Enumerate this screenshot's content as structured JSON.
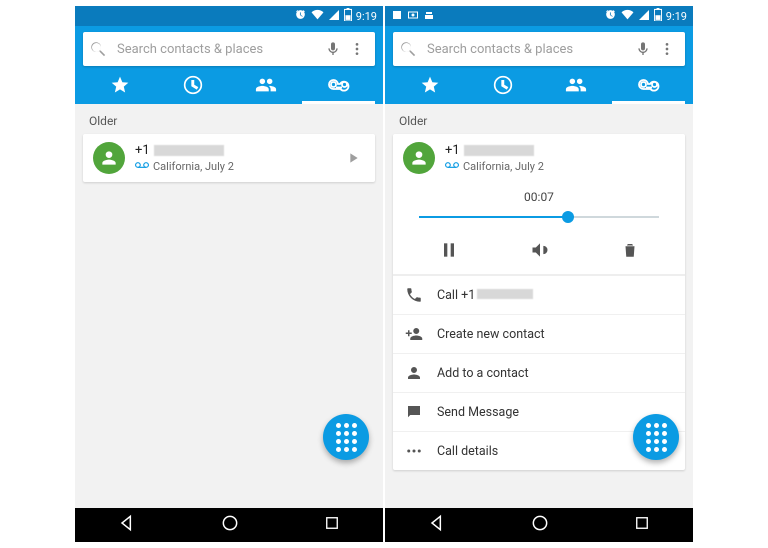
{
  "status": {
    "time": "9:19"
  },
  "search": {
    "placeholder": "Search contacts & places"
  },
  "section_label": "Older",
  "voicemail": {
    "number_prefix": "+1",
    "location": "California",
    "date": "July 2",
    "sub_joiner": ", "
  },
  "player": {
    "elapsed": "00:07",
    "progress_pct": 62
  },
  "actions": {
    "call_prefix": "Call +1",
    "create_contact": "Create new contact",
    "add_contact": "Add to a contact",
    "send_message": "Send Message",
    "call_details": "Call details"
  }
}
